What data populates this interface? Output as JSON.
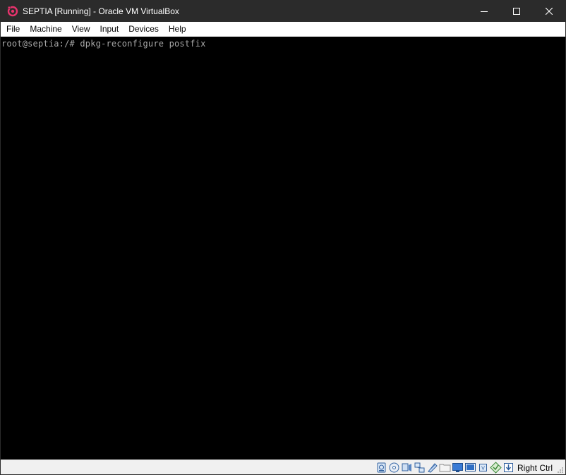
{
  "window": {
    "title": "SEPTIA [Running] - Oracle VM VirtualBox",
    "app_icon": "virtualbox-icon",
    "controls": [
      "minimize-icon",
      "maximize-icon",
      "close-icon"
    ]
  },
  "menu": {
    "items": [
      {
        "label": "File"
      },
      {
        "label": "Machine"
      },
      {
        "label": "View"
      },
      {
        "label": "Input"
      },
      {
        "label": "Devices"
      },
      {
        "label": "Help"
      }
    ]
  },
  "console": {
    "lines": [
      "root@septia:/# dpkg-reconfigure postfix"
    ],
    "background": "#000000",
    "text_color": "#a8a8a8"
  },
  "statusbar": {
    "icons": [
      "hard-disk-icon",
      "optical-drive-icon",
      "audio-icon",
      "network-icon",
      "usb-icon",
      "shared-folders-icon",
      "display-icon",
      "video-capture-icon",
      "cpu-icon",
      "mouse-integration-icon",
      "keyboard-capture-icon"
    ],
    "host_key": "Right Ctrl"
  },
  "colors": {
    "titlebar": "#2b2b2b",
    "menubar": "#ffffff",
    "statusbar": "#f0f0f0"
  }
}
